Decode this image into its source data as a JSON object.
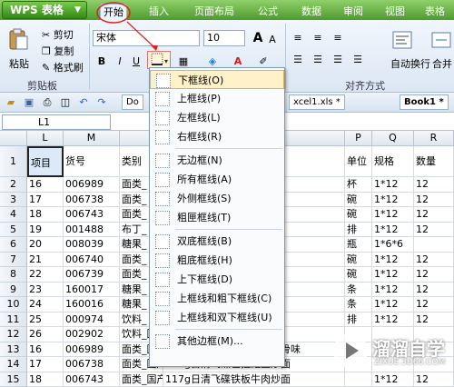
{
  "app": {
    "name": "WPS 表格",
    "menu_arrow": "▼"
  },
  "menu_tabs": [
    "开始",
    "插入",
    "页面布局",
    "公式",
    "数据",
    "审阅",
    "视图",
    "表格"
  ],
  "ribbon": {
    "paste": "粘贴",
    "cut": "剪切",
    "copy": "复制",
    "format_painter": "格式刷",
    "clipboard_group": "剪贴板",
    "font_name": "宋体",
    "font_size": "10",
    "bold": "B",
    "italic": "I",
    "underline": "U",
    "align_group": "对齐方式",
    "wrap_text": "自动换行",
    "merge": "合并"
  },
  "doc_tabs": {
    "tab_d": "Do",
    "tab_excel": "xcel1.xls *",
    "tab_book": "Book1 *"
  },
  "name_box": "L1",
  "columns_left": [
    "L",
    "M"
  ],
  "columns_right": [
    "P",
    "Q",
    "R"
  ],
  "header_row": {
    "row": "1",
    "item": "项目",
    "code": "货号",
    "cat": "类别",
    "mid": "",
    "unit": "单位",
    "spec": "规格",
    "qty": "数量"
  },
  "rows": [
    {
      "r": "2",
      "l": "16",
      "m": "006989",
      "n": "面类_",
      "o": "香油豚骨味",
      "p": "杯",
      "q": "1*12",
      "s": "12"
    },
    {
      "r": "3",
      "l": "17",
      "m": "006738",
      "n": "面类_",
      "o": "鲑鱼炒面",
      "p": "碗",
      "q": "1*12",
      "s": "12"
    },
    {
      "r": "4",
      "l": "18",
      "m": "006743",
      "n": "面类_",
      "o": "牛肉炒面",
      "p": "碗",
      "q": "1*12",
      "s": "12"
    },
    {
      "r": "5",
      "l": "19",
      "m": "001488",
      "n": "布丁_",
      "o": "丁芒果味",
      "p": "排",
      "q": "1*12",
      "s": "12"
    },
    {
      "r": "6",
      "l": "20",
      "m": "008039",
      "n": "糖果_",
      "o": "",
      "p": "瓶",
      "q": "1*6*6",
      "s": ""
    },
    {
      "r": "7",
      "l": "21",
      "m": "006740",
      "n": "面类_",
      "o": "XO海鲜酱",
      "p": "碗",
      "q": "1*12",
      "s": "12"
    },
    {
      "r": "8",
      "l": "22",
      "m": "006739",
      "n": "面类_",
      "o": "牛肉炒面",
      "p": "碗",
      "q": "1*12",
      "s": "12"
    },
    {
      "r": "9",
      "l": "23",
      "m": "160017",
      "n": "糖果_",
      "o": "软糖",
      "p": "条",
      "q": "1*12",
      "s": "12"
    },
    {
      "r": "10",
      "l": "24",
      "m": "160016",
      "n": "糖果_",
      "o": "心子软糖",
      "p": "条",
      "q": "1*12",
      "s": "12"
    },
    {
      "r": "11",
      "l": "25",
      "m": "000974",
      "n": "饮料_",
      "o": "红茶豆奶",
      "p": "排",
      "q": "1*12",
      "s": "12"
    },
    {
      "r": "12",
      "l": "26",
      "m": "002902",
      "n": "饮料_国产",
      "o": "125Ml维他豆奶原味",
      "p": "",
      "q": "",
      "s": ""
    },
    {
      "r": "13",
      "l": "16",
      "m": "006989",
      "n": "面类_国产",
      "o": "116g日清拉面王黑香油豚骨味",
      "p": "",
      "q": "",
      "s": ""
    },
    {
      "r": "14",
      "l": "17",
      "m": "006738",
      "n": "面类_国产",
      "o": "117g日清飞碟色拉鲑鱼炒面",
      "p": "",
      "q": "",
      "s": ""
    },
    {
      "r": "15",
      "l": "18",
      "m": "006743",
      "n": "面类_国产",
      "o": "117g日清飞碟铁板牛肉炒面",
      "p": "",
      "q": "1*12",
      "s": "12"
    }
  ],
  "border_menu": {
    "items": [
      {
        "label": "下框线(O)",
        "icon": "bottom-border-icon"
      },
      {
        "label": "上框线(P)",
        "icon": "top-border-icon"
      },
      {
        "label": "左框线(L)",
        "icon": "left-border-icon"
      },
      {
        "label": "右框线(R)",
        "icon": "right-border-icon"
      },
      {
        "label": "无边框(N)",
        "icon": "no-border-icon"
      },
      {
        "label": "所有框线(A)",
        "icon": "all-borders-icon"
      },
      {
        "label": "外侧框线(S)",
        "icon": "outside-borders-icon"
      },
      {
        "label": "粗匣框线(T)",
        "icon": "thick-box-border-icon"
      },
      {
        "label": "双底框线(B)",
        "icon": "double-bottom-border-icon"
      },
      {
        "label": "粗底框线(H)",
        "icon": "thick-bottom-border-icon"
      },
      {
        "label": "上下框线(D)",
        "icon": "top-bottom-border-icon"
      },
      {
        "label": "上框线和粗下框线(C)",
        "icon": "top-thick-bottom-border-icon"
      },
      {
        "label": "上框线和双下框线(U)",
        "icon": "top-double-bottom-border-icon"
      },
      {
        "label": "其他边框(M)...",
        "icon": "more-borders-icon"
      }
    ]
  },
  "watermark": {
    "title": "溜溜自学",
    "url": "ZIXUE.3D66.COM"
  },
  "colors": {
    "title_green": "#4e9a2e",
    "annotation_red": "#e02020",
    "selected_blue": "#dbe9f8"
  }
}
